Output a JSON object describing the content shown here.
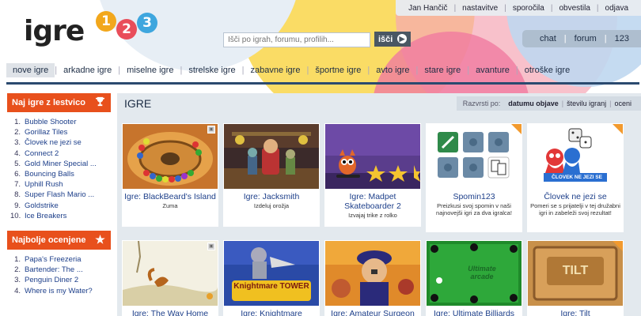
{
  "logo": {
    "word": "igre",
    "digits": [
      "1",
      "2",
      "3"
    ]
  },
  "search": {
    "placeholder": "Išči po igrah, forumu, profilih...",
    "button_label": "išči",
    "button_icon": "arrow-right-icon"
  },
  "top_links": [
    "Jan Hančič",
    "nastavitve",
    "sporočila",
    "obvestila",
    "odjava"
  ],
  "pills": [
    "chat",
    "forum",
    "123"
  ],
  "main_nav": {
    "active": "nove igre",
    "items": [
      "nove igre",
      "arkadne igre",
      "miselne igre",
      "strelske igre",
      "zabavne igre",
      "športne igre",
      "avto igre",
      "stare igre",
      "avanture",
      "otroške igre"
    ]
  },
  "top_list": {
    "title": "Naj igre z lestvico",
    "icon": "trophy-icon",
    "items": [
      {
        "n": "1.",
        "t": "Bubble Shooter"
      },
      {
        "n": "2.",
        "t": "Gorillaz Tiles"
      },
      {
        "n": "3.",
        "t": "Človek ne jezi se"
      },
      {
        "n": "4.",
        "t": "Connect 2"
      },
      {
        "n": "5.",
        "t": "Gold Miner Special ..."
      },
      {
        "n": "6.",
        "t": "Bouncing Balls"
      },
      {
        "n": "7.",
        "t": "Uphill Rush"
      },
      {
        "n": "8.",
        "t": "Super Flash Mario ..."
      },
      {
        "n": "9.",
        "t": "Goldstrike"
      },
      {
        "n": "10.",
        "t": "Ice Breakers"
      }
    ]
  },
  "rated_list": {
    "title": "Najbolje ocenjene",
    "icon": "star-icon",
    "items": [
      {
        "n": "1.",
        "t": "Papa's Freezeria"
      },
      {
        "n": "2.",
        "t": "Bartender: The ..."
      },
      {
        "n": "3.",
        "t": "Penguin Diner 2"
      },
      {
        "n": "4.",
        "t": "Where is my Water?"
      }
    ]
  },
  "content": {
    "title": "IGRE",
    "sort": {
      "label": "Razvrsti po:",
      "options": [
        "datumu objave",
        "številu igranj",
        "oceni"
      ],
      "active": "datumu objave"
    }
  },
  "games": [
    {
      "title": "Igre: BlackBeard's Island",
      "subtitle": "Zuma",
      "thumb": "zuma"
    },
    {
      "title": "Igre: Jacksmith",
      "subtitle": "Izdeluj orožja",
      "thumb": "jacksmith"
    },
    {
      "title": "Igre: Madpet Skateboarder 2",
      "subtitle": "Izvajaj trike z rolko",
      "thumb": "madpet"
    },
    {
      "title": "Spomin123",
      "subtitle": "Preizkusi svoj spomin v naši najnovejši igri za dva igralca!",
      "thumb": "spomin"
    },
    {
      "title": "Človek ne jezi se",
      "subtitle": "Pomeri se s prijatelji v tej družabni igri in zabeleži svoj rezultat!",
      "thumb": "clovek",
      "thumb_label": "ČLOVEK NE JEZI SE"
    },
    {
      "title": "Igre: The Way Home",
      "subtitle": "",
      "thumb": "wayhome"
    },
    {
      "title": "Igre: Knightmare",
      "subtitle": "",
      "thumb": "knightmare",
      "thumb_label": "Knightmare TOWER"
    },
    {
      "title": "Igre: Amateur Surgeon",
      "subtitle": "",
      "thumb": "surgeon"
    },
    {
      "title": "Igre: Ultimate Billiards",
      "subtitle": "",
      "thumb": "billiards",
      "thumb_label": "Ultimate arcade"
    },
    {
      "title": "Igre: Tilt",
      "subtitle": "",
      "thumb": "tilt",
      "thumb_label": "TILT"
    }
  ],
  "colors": {
    "accent": "#e8501c",
    "nav_line": "#2b4a6f",
    "link": "#1d3f8a"
  }
}
